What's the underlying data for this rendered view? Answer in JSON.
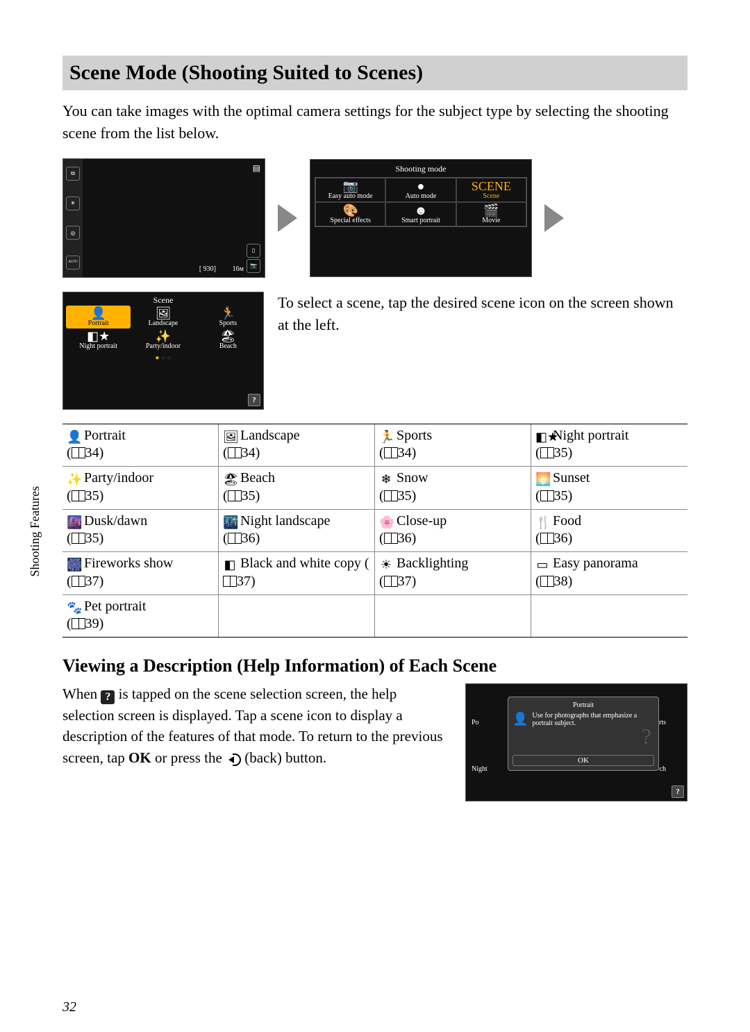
{
  "heading": "Scene Mode (Shooting Suited to Scenes)",
  "intro": "You can take images with the optimal camera settings for the subject type by selecting the shooting scene from the list below.",
  "sideTab": "Shooting Features",
  "lcd1": {
    "icons": [
      "⧉",
      "☀",
      "◎",
      "ᴬᵁᵀᴼ"
    ],
    "br": "16ᴍ",
    "br2": "[ 930]"
  },
  "lcd2": {
    "title": "Shooting mode",
    "cells": [
      {
        "ic": "📷",
        "l": "Easy auto mode"
      },
      {
        "ic": "●",
        "l": "Auto mode"
      },
      {
        "ic": "SCENE",
        "l": "Scene",
        "sel": true
      },
      {
        "ic": "🎨",
        "l": "Special effects"
      },
      {
        "ic": "☻",
        "l": "Smart portrait"
      },
      {
        "ic": "🎬",
        "l": "Movie"
      }
    ]
  },
  "lcd3": {
    "title": "Scene",
    "cells": [
      {
        "ic": "👤",
        "l": "Portrait",
        "sel": true
      },
      {
        "ic": "🖼",
        "l": "Landscape"
      },
      {
        "ic": "🏃",
        "l": "Sports"
      },
      {
        "ic": "◧★",
        "l": "Night portrait"
      },
      {
        "ic": "✨",
        "l": "Party/indoor"
      },
      {
        "ic": "🏖",
        "l": "Beach"
      }
    ]
  },
  "selectText": "To select a scene, tap the desired scene icon on the screen shown at the left.",
  "table": [
    [
      {
        "ic": "👤",
        "n": "Portrait",
        "p": "34"
      },
      {
        "ic": "🖼",
        "n": "Landscape",
        "p": "34"
      },
      {
        "ic": "🏃",
        "n": "Sports",
        "p": "34"
      },
      {
        "ic": "◧★",
        "n": "Night portrait",
        "p": "35"
      }
    ],
    [
      {
        "ic": "✨",
        "n": "Party/indoor",
        "p": "35"
      },
      {
        "ic": "🏖",
        "n": "Beach",
        "p": "35"
      },
      {
        "ic": "❄",
        "n": "Snow",
        "p": "35"
      },
      {
        "ic": "🌅",
        "n": "Sunset",
        "p": "35"
      }
    ],
    [
      {
        "ic": "🌆",
        "n": "Dusk/dawn",
        "p": "35"
      },
      {
        "ic": "🌃",
        "n": "Night landscape",
        "p": "36"
      },
      {
        "ic": "🌸",
        "n": "Close-up",
        "p": "36"
      },
      {
        "ic": "🍴",
        "n": "Food",
        "p": "36"
      }
    ],
    [
      {
        "ic": "🎆",
        "n": "Fireworks show",
        "p": "37"
      },
      {
        "ic": "◧",
        "n": "Black and white copy",
        "p": "37",
        "inline": true
      },
      {
        "ic": "☀",
        "n": "Backlighting",
        "p": "37"
      },
      {
        "ic": "▭",
        "n": "Easy panorama",
        "p": "38"
      }
    ],
    [
      {
        "ic": "🐾",
        "n": "Pet portrait",
        "p": "39"
      }
    ]
  ],
  "subheading": "Viewing a Description (Help Information) of Each Scene",
  "help": {
    "t1": "When ",
    "t2": " is tapped on the scene selection screen, the help selection screen is displayed. Tap a scene icon to display a description of the features of that mode. To return to the previous screen, tap ",
    "ok": "OK",
    "t3": " or press the ",
    "t4": " (back) button."
  },
  "lcd4": {
    "title": "Portrait",
    "desc": "Use for photographs that emphasize a portrait subject.",
    "ok": "OK",
    "left": "Po",
    "right": "rts",
    "bl": "Night",
    "br": "ch"
  },
  "pageNum": "32"
}
